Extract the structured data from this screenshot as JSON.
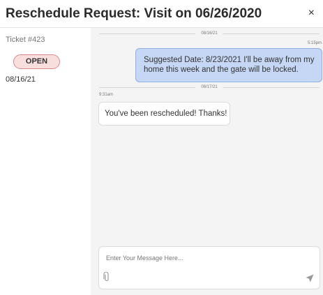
{
  "dialog": {
    "title": "Reschedule Request: Visit on 06/26/2020",
    "close_symbol": "×"
  },
  "sidebar": {
    "ticket_number": "Ticket #423",
    "status": "OPEN",
    "date": "08/16/21"
  },
  "conversation": {
    "groups": [
      {
        "date": "08/16/21",
        "messages": [
          {
            "direction": "outgoing",
            "time": "5:15pm",
            "text": "Suggested Date: 8/23/2021 I'll be away from my home this week and the gate will be locked."
          }
        ]
      },
      {
        "date": "08/17/21",
        "messages": [
          {
            "direction": "incoming",
            "time": "9:31am",
            "text": "You've been rescheduled! Thanks!"
          }
        ]
      }
    ]
  },
  "composer": {
    "placeholder": "Enter Your Message Here..."
  },
  "icons": {
    "attach": "paperclip-icon",
    "send": "send-icon",
    "close": "close-icon"
  },
  "colors": {
    "outgoing_bubble": "#c5d7f4",
    "outgoing_border": "#8fb0e6",
    "status_badge_bg": "#f9dede",
    "status_badge_border": "#d88a8a",
    "chat_background": "#f4f4f4"
  }
}
